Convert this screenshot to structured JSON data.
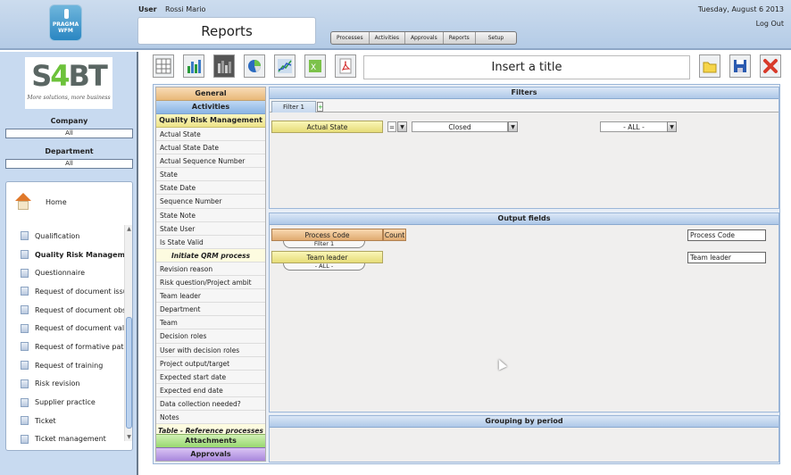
{
  "header": {
    "logo_text": "PRAGMA WFM",
    "user_label": "User",
    "user_name": "Rossi Mario",
    "page_title": "Reports",
    "date": "Tuesday, August 6 2013",
    "logout": "Log Out",
    "nav": [
      "Processes",
      "Activities",
      "Approvals",
      "Reports",
      "Setup"
    ]
  },
  "sidebar": {
    "brand": {
      "left": "S",
      "mid": "4",
      "right": "BT",
      "tagline": "More solutions, more business"
    },
    "company_label": "Company",
    "company_value": "All",
    "department_label": "Department",
    "department_value": "All",
    "home_label": "Home",
    "processes": [
      {
        "label": "Qualification",
        "bold": false
      },
      {
        "label": "Quality Risk Managemen",
        "bold": true
      },
      {
        "label": "Questionnaire",
        "bold": false
      },
      {
        "label": "Request of document issu",
        "bold": false
      },
      {
        "label": "Request of document obs",
        "bold": false
      },
      {
        "label": "Request of document vali",
        "bold": false
      },
      {
        "label": "Request of formative path",
        "bold": false
      },
      {
        "label": "Request of training",
        "bold": false
      },
      {
        "label": "Risk revision",
        "bold": false
      },
      {
        "label": "Supplier practice",
        "bold": false
      },
      {
        "label": "Ticket",
        "bold": false
      },
      {
        "label": "Ticket management",
        "bold": false
      }
    ]
  },
  "toolbar": {
    "icons": [
      "table-icon",
      "bar-chart-icon",
      "stacked-bar-chart-icon",
      "pie-chart-icon",
      "line-chart-icon",
      "excel-export-icon",
      "pdf-export-icon"
    ],
    "title_placeholder": "Insert a title",
    "right_icons": [
      "open-folder-icon",
      "save-icon",
      "close-icon"
    ]
  },
  "fields_panel": {
    "general": "General",
    "activities": "Activities",
    "process_title": "Quality Risk Management",
    "group1": [
      "Actual State",
      "Actual State Date",
      "Actual Sequence Number",
      "State",
      "State Date",
      "Sequence Number",
      "State Note",
      "State User",
      "Is State Valid"
    ],
    "subheading": "Initiate QRM process",
    "group2": [
      "Revision reason",
      "Risk question/Project ambit",
      "Team leader",
      "Department",
      "Team",
      "Decision roles",
      "User with decision roles",
      "Project output/target",
      "Expected start date",
      "Expected end date",
      "Data collection needed?",
      "Notes"
    ],
    "table_heading": "Table - Reference processes",
    "attachments": "Attachments",
    "approvals": "Approvals"
  },
  "filters": {
    "title": "Filters",
    "tab": "Filter 1",
    "add_tab": "+",
    "field": "Actual State",
    "operator": "=",
    "value": "Closed",
    "second_value": "- ALL -"
  },
  "outputs": {
    "title": "Output fields",
    "rows": [
      {
        "field": "Process Code",
        "aggregate": "Count",
        "sub": "Filter 1",
        "alias": "Process Code"
      },
      {
        "field": "Team leader",
        "aggregate": "",
        "sub": "- ALL -",
        "alias": "Team leader"
      }
    ]
  },
  "grouping": {
    "title": "Grouping by period"
  },
  "colors": {
    "accent": "#aec8e8",
    "general": "#e8b878",
    "qrm": "#eee48a",
    "attachments": "#98d870",
    "approvals": "#a888dc"
  }
}
